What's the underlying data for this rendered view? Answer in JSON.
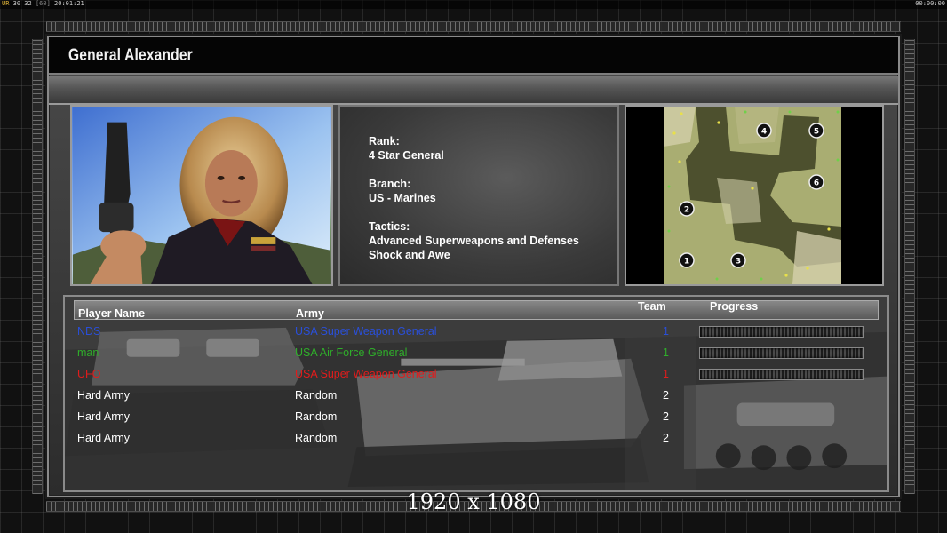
{
  "status": {
    "left_ur": "UR",
    "left_values": "30 32",
    "left_bracket": "[60]",
    "left_time": "20:01:21",
    "right_time": "00:00:00"
  },
  "title": "General Alexander",
  "general": {
    "rank_label": "Rank:",
    "rank_value": "4 Star General",
    "branch_label": "Branch:",
    "branch_value": "US - Marines",
    "tactics_label": "Tactics:",
    "tactics_line1": "Advanced Superweapons and Defenses",
    "tactics_line2": "Shock and Awe"
  },
  "map": {
    "start_positions": [
      "1",
      "2",
      "3",
      "4",
      "5",
      "6"
    ]
  },
  "table": {
    "headers": {
      "player_name": "Player Name",
      "army": "Army",
      "team": "Team",
      "progress": "Progress"
    },
    "rows": [
      {
        "player": "NDS",
        "army": "USA Super Weapon General",
        "team": "1",
        "color": "#2a4fd8",
        "has_progress": true
      },
      {
        "player": "man",
        "army": "USA Air Force General",
        "team": "1",
        "color": "#2fae2a",
        "has_progress": true
      },
      {
        "player": "UFO",
        "army": "USA Super Weapon General",
        "team": "1",
        "color": "#e01c1c",
        "has_progress": true
      },
      {
        "player": "Hard Army",
        "army": "Random",
        "team": "2",
        "color": "#ffffff",
        "has_progress": false
      },
      {
        "player": "Hard Army",
        "army": "Random",
        "team": "2",
        "color": "#ffffff",
        "has_progress": false
      },
      {
        "player": "Hard Army",
        "army": "Random",
        "team": "2",
        "color": "#ffffff",
        "has_progress": false
      }
    ]
  },
  "resolution_caption": "1920 x 1080"
}
